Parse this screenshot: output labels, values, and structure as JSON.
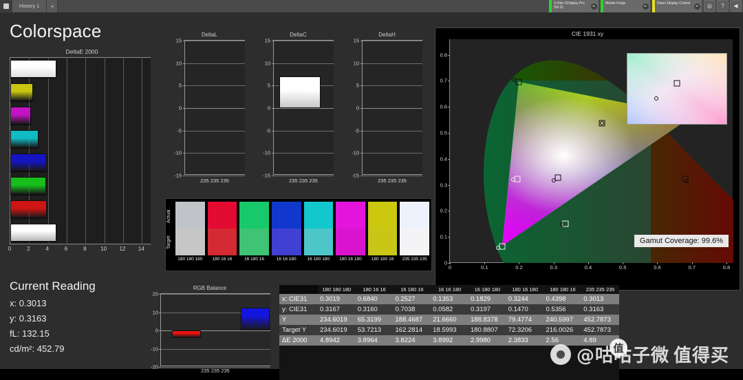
{
  "titlebar": {
    "logo_icon": "app-logo-icon",
    "tabs": [
      {
        "label": "History 1"
      }
    ],
    "add_tab_label": "+",
    "devices": [
      {
        "name": "X-Rite i1Display Pro\nSN 31",
        "status_color": "#2fd32f"
      },
      {
        "name": "Mobile Forge",
        "status_color": "#2fd32f"
      },
      {
        "name": "Direct Display Control",
        "status_color": "#e8e020"
      }
    ],
    "buttons": [
      {
        "icon": "camera-icon",
        "label": "◎"
      },
      {
        "icon": "help-icon",
        "label": "?"
      },
      {
        "icon": "menu-icon",
        "label": "◀"
      }
    ]
  },
  "page": {
    "title": "Colorspace"
  },
  "chart_data": [
    {
      "type": "bar",
      "title": "DeltaE 2000",
      "orientation": "horizontal",
      "xlabel": "",
      "ylabel": "",
      "xlim": [
        0,
        15
      ],
      "xticks": [
        0,
        2,
        4,
        6,
        8,
        10,
        12,
        14
      ],
      "grid": true,
      "categories": [
        "235 235 235",
        "180 180 16",
        "180 16 180",
        "16 180 180",
        "16 16 180",
        "16 180 16",
        "180 16 16",
        "180 180 180"
      ],
      "values": [
        4.8942,
        2.3833,
        2.2,
        2.998,
        3.8992,
        3.8224,
        3.8964,
        4.8942
      ],
      "colors": [
        "#ffffff",
        "#c9c511",
        "#c312c3",
        "#10bcc4",
        "#1414c0",
        "#17bf1b",
        "#cf1414",
        "#d2d2d2"
      ]
    },
    {
      "type": "bar",
      "title": "DeltaL",
      "categories": [
        "235 235 235"
      ],
      "values": [
        0
      ],
      "ylim": [
        -15,
        15
      ],
      "yticks": [
        15,
        10,
        5,
        0,
        -5,
        -10,
        -15
      ],
      "xlabel": "235 235 235",
      "grid": true
    },
    {
      "type": "bar",
      "title": "DeltaC",
      "categories": [
        "235 235 235"
      ],
      "values": [
        7.0
      ],
      "ylim": [
        -15,
        15
      ],
      "yticks": [
        15,
        10,
        5,
        0,
        -5,
        -10,
        -15
      ],
      "xlabel": "235 235 235",
      "grid": true
    },
    {
      "type": "bar",
      "title": "DeltaH",
      "categories": [
        "235 235 235"
      ],
      "values": [
        0
      ],
      "ylim": [
        -15,
        15
      ],
      "yticks": [
        15,
        10,
        5,
        0,
        -5,
        -10,
        -15
      ],
      "xlabel": "235 235 235",
      "grid": true
    },
    {
      "type": "bar",
      "title": "RGB Balance",
      "categories": [
        "Red",
        "Green",
        "Blue"
      ],
      "values": [
        -4.3,
        0,
        12.3
      ],
      "ylim": [
        -20,
        20
      ],
      "yticks": [
        20,
        10,
        0,
        -10,
        -20
      ],
      "xlabel": "235 235 235",
      "colors": [
        "#ef1111",
        "#17bf1b",
        "#1515e0"
      ],
      "grid": true
    },
    {
      "type": "scatter",
      "title": "CIE 1931 xy",
      "xlabel": "",
      "ylabel": "",
      "xlim": [
        0,
        0.8
      ],
      "ylim": [
        0,
        0.85
      ],
      "xticks": [
        "0",
        "0.1",
        "0.2",
        "0.3",
        "0.4",
        "0.5",
        "0.6",
        "0.7",
        "0.8"
      ],
      "yticks": [
        "0",
        "0.1",
        "0.2",
        "0.3",
        "0.4",
        "0.5",
        "0.6",
        "0.7",
        "0.8"
      ],
      "annotation": "Gamut Coverage:  99.6%",
      "points": [
        {
          "name": "red-target",
          "marker": "square",
          "x": 0.68,
          "y": 0.322,
          "light": false
        },
        {
          "name": "red-actual",
          "marker": "circle",
          "x": 0.684,
          "y": 0.316,
          "light": false
        },
        {
          "name": "green-target",
          "marker": "square",
          "x": 0.2,
          "y": 0.695,
          "light": false
        },
        {
          "name": "green-actual",
          "marker": "circle",
          "x": 0.186,
          "y": 0.704,
          "light": false
        },
        {
          "name": "blue-target",
          "marker": "square",
          "x": 0.152,
          "y": 0.063,
          "light": true
        },
        {
          "name": "blue-actual",
          "marker": "circle",
          "x": 0.139,
          "y": 0.058,
          "light": true
        },
        {
          "name": "cyan-target",
          "marker": "square",
          "x": 0.195,
          "y": 0.324,
          "light": true
        },
        {
          "name": "cyan-actual",
          "marker": "circle",
          "x": 0.183,
          "y": 0.32,
          "light": true
        },
        {
          "name": "magenta-target",
          "marker": "square",
          "x": 0.335,
          "y": 0.152,
          "light": true
        },
        {
          "name": "magenta-actual",
          "marker": "circle",
          "x": 0.324,
          "y": 0.147,
          "light": false
        },
        {
          "name": "yellow-target",
          "marker": "square",
          "x": 0.44,
          "y": 0.538,
          "light": false
        },
        {
          "name": "yellow-actual",
          "marker": "circle",
          "x": 0.44,
          "y": 0.536,
          "light": false
        },
        {
          "name": "white-target",
          "marker": "square",
          "x": 0.313,
          "y": 0.329,
          "light": false
        },
        {
          "name": "white-actual",
          "marker": "circle",
          "x": 0.3013,
          "y": 0.3163,
          "light": false
        }
      ],
      "inset": {
        "name": "white-point-zoom",
        "points": [
          {
            "name": "white-target",
            "marker": "square",
            "x": 0.5,
            "y": 0.42,
            "light": false
          },
          {
            "name": "white-actual",
            "marker": "circle",
            "x": 0.29,
            "y": 0.64,
            "light": false
          }
        ]
      }
    }
  ],
  "swatches": {
    "actual_label": "Actual",
    "target_label": "Target",
    "columns": [
      {
        "label": "180 180 180",
        "actual": "#c0c4c9",
        "target": "#c6c6c6"
      },
      {
        "label": "180 16 16",
        "actual": "#e40b33",
        "target": "#d42a33"
      },
      {
        "label": "16 180 16",
        "actual": "#18c96b",
        "target": "#3fc374"
      },
      {
        "label": "16 16 180",
        "actual": "#1138cd",
        "target": "#4040d2"
      },
      {
        "label": "16 180 180",
        "actual": "#13c7cf",
        "target": "#4dc6c9"
      },
      {
        "label": "180 16 180",
        "actual": "#e315dc",
        "target": "#d914cf"
      },
      {
        "label": "180 180 16",
        "actual": "#cbc80f",
        "target": "#c9c617"
      },
      {
        "label": "235 235 235",
        "actual": "#eef2fc",
        "target": "#f4f4f6"
      }
    ]
  },
  "current_reading": {
    "title": "Current Reading",
    "x_label": "x: 0.3013",
    "y_label": "y: 0.3163",
    "fl_label": "fL: 132.15",
    "cd_label": "cd/m²: 452.79"
  },
  "table": {
    "columns": [
      "",
      "180 180 180",
      "180 16 16",
      "16 180 16",
      "16 16 180",
      "16 180 180",
      "180 16 180",
      "180 180 16",
      "235 235 235"
    ],
    "rows": [
      {
        "label": "x: CIE31",
        "values": [
          "0.3019",
          "0.6840",
          "0.2527",
          "0.1353",
          "0.1829",
          "0.3244",
          "0.4398",
          "0.3013"
        ]
      },
      {
        "label": "y: CIE31",
        "values": [
          "0.3167",
          "0.3160",
          "0.7038",
          "0.0582",
          "0.3197",
          "0.1470",
          "0.5356",
          "0.3163"
        ]
      },
      {
        "label": "Y",
        "values": [
          "234.6019",
          "65.3199",
          "188.4687",
          "21.6660",
          "188.8378",
          "79.4774",
          "240.5997",
          "452.7873"
        ]
      },
      {
        "label": "Target Y",
        "values": [
          "234.6019",
          "53.7213",
          "162.2814",
          "18.5993",
          "180.8807",
          "72.3206",
          "216.0026",
          "452.7873"
        ]
      },
      {
        "label": "ΔE 2000",
        "values": [
          "4.8942",
          "3.8964",
          "3.8224",
          "3.8992",
          "2.9980",
          "2.3833",
          "2.56",
          "4.89"
        ]
      }
    ]
  },
  "watermark": {
    "handle": "@咕咕子微",
    "site": "值得买"
  },
  "colors": {
    "background": "#2d2d2d",
    "panel": "#1e1e1e",
    "titlebar": "#4a4a4a",
    "accent_green": "#2fd32f",
    "accent_yellow": "#e8e020"
  }
}
